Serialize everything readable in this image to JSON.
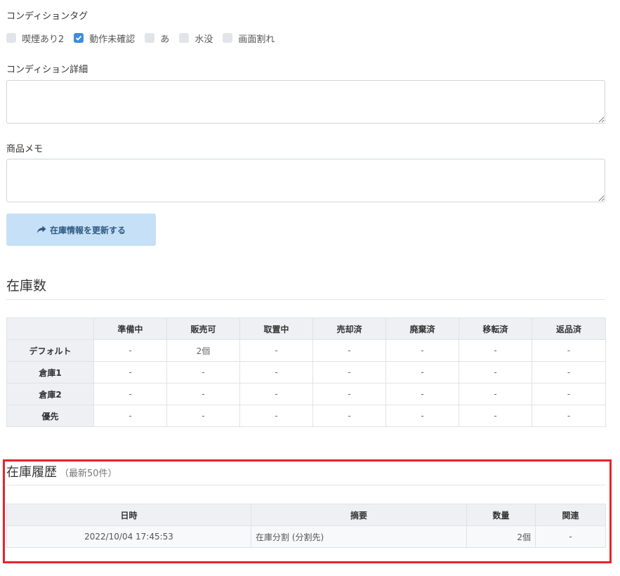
{
  "condition_tags": {
    "label": "コンディションタグ",
    "items": [
      {
        "label": "喫煙あり2",
        "checked": false
      },
      {
        "label": "動作未確認",
        "checked": true
      },
      {
        "label": "あ",
        "checked": false
      },
      {
        "label": "水没",
        "checked": false
      },
      {
        "label": "画面割れ",
        "checked": false
      }
    ]
  },
  "condition_detail": {
    "label": "コンディション詳細",
    "value": ""
  },
  "product_memo": {
    "label": "商品メモ",
    "value": ""
  },
  "update_button": {
    "label": "在庫情報を更新する",
    "icon": "share-arrow-icon"
  },
  "stock": {
    "title": "在庫数",
    "headers": [
      "",
      "準備中",
      "販売可",
      "取置中",
      "売却済",
      "廃棄済",
      "移転済",
      "返品済"
    ],
    "rows": [
      {
        "name": "デフォルト",
        "cells": [
          "-",
          "2個",
          "-",
          "-",
          "-",
          "-",
          "-"
        ]
      },
      {
        "name": "倉庫1",
        "cells": [
          "-",
          "-",
          "-",
          "-",
          "-",
          "-",
          "-"
        ]
      },
      {
        "name": "倉庫2",
        "cells": [
          "-",
          "-",
          "-",
          "-",
          "-",
          "-",
          "-"
        ]
      },
      {
        "name": "優先",
        "cells": [
          "-",
          "-",
          "-",
          "-",
          "-",
          "-",
          "-"
        ]
      }
    ]
  },
  "history": {
    "title": "在庫履歴",
    "subtitle": "（最新50件）",
    "headers": [
      "日時",
      "摘要",
      "数量",
      "関連"
    ],
    "rows": [
      {
        "datetime": "2022/10/04 17:45:53",
        "summary": "在庫分割 (分割先)",
        "quantity": "2個",
        "related": "-"
      }
    ],
    "highlight_color": "#e8232a"
  },
  "colors": {
    "accent": "#3e8ddd",
    "button_bg": "#c6e0f7"
  }
}
